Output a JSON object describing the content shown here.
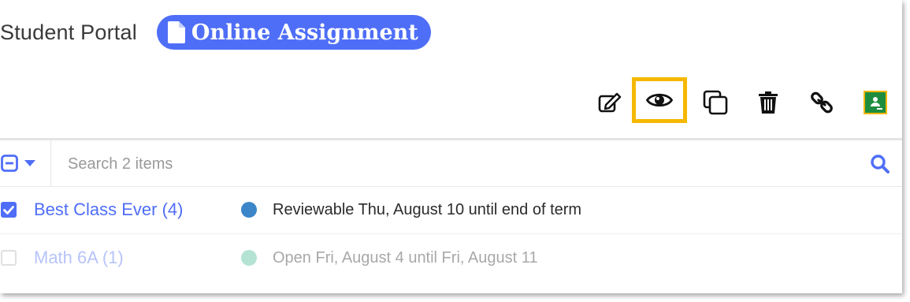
{
  "header": {
    "title": "Student Portal",
    "badge_label": "Online Assignment",
    "badge_icon": "document-icon",
    "badge_color": "#4f6ef7"
  },
  "toolbar": {
    "actions": [
      {
        "name": "edit",
        "icon": "edit-icon"
      },
      {
        "name": "preview",
        "icon": "eye-icon",
        "highlighted": true
      },
      {
        "name": "copy",
        "icon": "copy-icon"
      },
      {
        "name": "delete",
        "icon": "trash-icon"
      },
      {
        "name": "link",
        "icon": "link-icon"
      },
      {
        "name": "google-classroom",
        "icon": "google-classroom-icon"
      }
    ],
    "highlight_color": "#f5b800"
  },
  "search": {
    "placeholder": "Search 2 items",
    "value": ""
  },
  "classes": [
    {
      "name": "Best Class Ever (4)",
      "checked": true,
      "status": "Reviewable Thu, August 10 until end of term",
      "status_color": "#3a86c8"
    },
    {
      "name": "Math 6A (1)",
      "checked": false,
      "status": "Open Fri, August 4 until Fri, August 11",
      "status_color": "#b4e3d3"
    }
  ]
}
